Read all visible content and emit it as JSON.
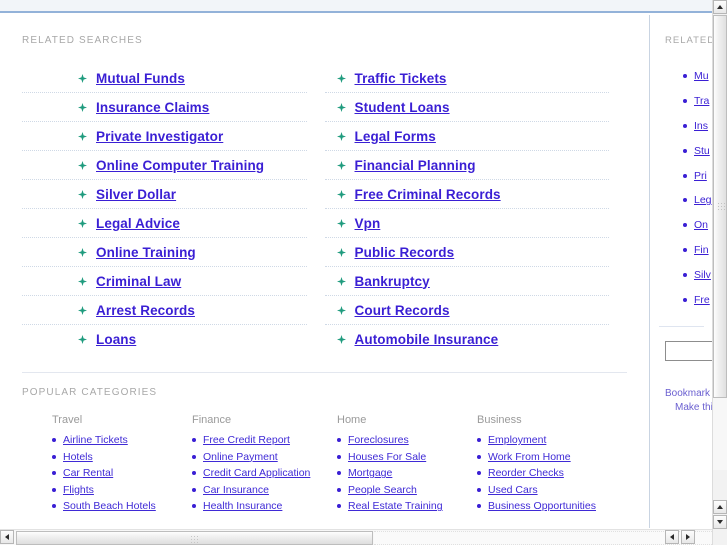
{
  "window": {
    "background_color": "#ffffff",
    "header_band_color": "#f2f5f9",
    "header_rule_color": "#93b2d9",
    "link_color": "#3a1fd4",
    "label_color": "#a8a8a8",
    "bullet_icon": "star-bullet-icon",
    "dot_icon": "dot-bullet-icon"
  },
  "related_searches": {
    "label": "RELATED SEARCHES",
    "left_column": [
      {
        "label": "Mutual Funds"
      },
      {
        "label": "Insurance Claims"
      },
      {
        "label": "Private Investigator"
      },
      {
        "label": "Online Computer Training"
      },
      {
        "label": "Silver Dollar"
      },
      {
        "label": "Legal Advice"
      },
      {
        "label": "Online Training"
      },
      {
        "label": "Criminal Law"
      },
      {
        "label": "Arrest Records"
      },
      {
        "label": "Loans"
      }
    ],
    "right_column": [
      {
        "label": "Traffic Tickets"
      },
      {
        "label": "Student Loans"
      },
      {
        "label": "Legal Forms"
      },
      {
        "label": "Financial Planning"
      },
      {
        "label": "Free Criminal Records"
      },
      {
        "label": "Vpn"
      },
      {
        "label": "Public Records"
      },
      {
        "label": "Bankruptcy"
      },
      {
        "label": "Court Records"
      },
      {
        "label": "Automobile Insurance"
      }
    ]
  },
  "popular_categories": {
    "label": "POPULAR CATEGORIES",
    "columns": [
      {
        "title": "Travel",
        "items": [
          "Airline Tickets",
          "Hotels",
          "Car Rental",
          "Flights",
          "South Beach Hotels"
        ]
      },
      {
        "title": "Finance",
        "items": [
          "Free Credit Report",
          "Online Payment",
          "Credit Card Application",
          "Car Insurance",
          "Health Insurance"
        ]
      },
      {
        "title": "Home",
        "items": [
          "Foreclosures",
          "Houses For Sale",
          "Mortgage",
          "People Search",
          "Real Estate Training"
        ]
      },
      {
        "title": "Business",
        "items": [
          "Employment",
          "Work From Home",
          "Reorder Checks",
          "Used Cars",
          "Business Opportunities"
        ]
      }
    ]
  },
  "side_panel": {
    "label": "RELATED",
    "items": [
      "Mu",
      "Tra",
      "Ins",
      "Stu",
      "Pri",
      "Leg",
      "On",
      "Fin",
      "Silv",
      "Fre"
    ],
    "search_value": "",
    "search_placeholder": "",
    "footer_links": [
      "Bookmark",
      "Make this"
    ]
  },
  "scrollbars": {
    "vertical_up": "▲",
    "vertical_down": "▼",
    "horizontal_left": "◀",
    "horizontal_right": "▶"
  }
}
